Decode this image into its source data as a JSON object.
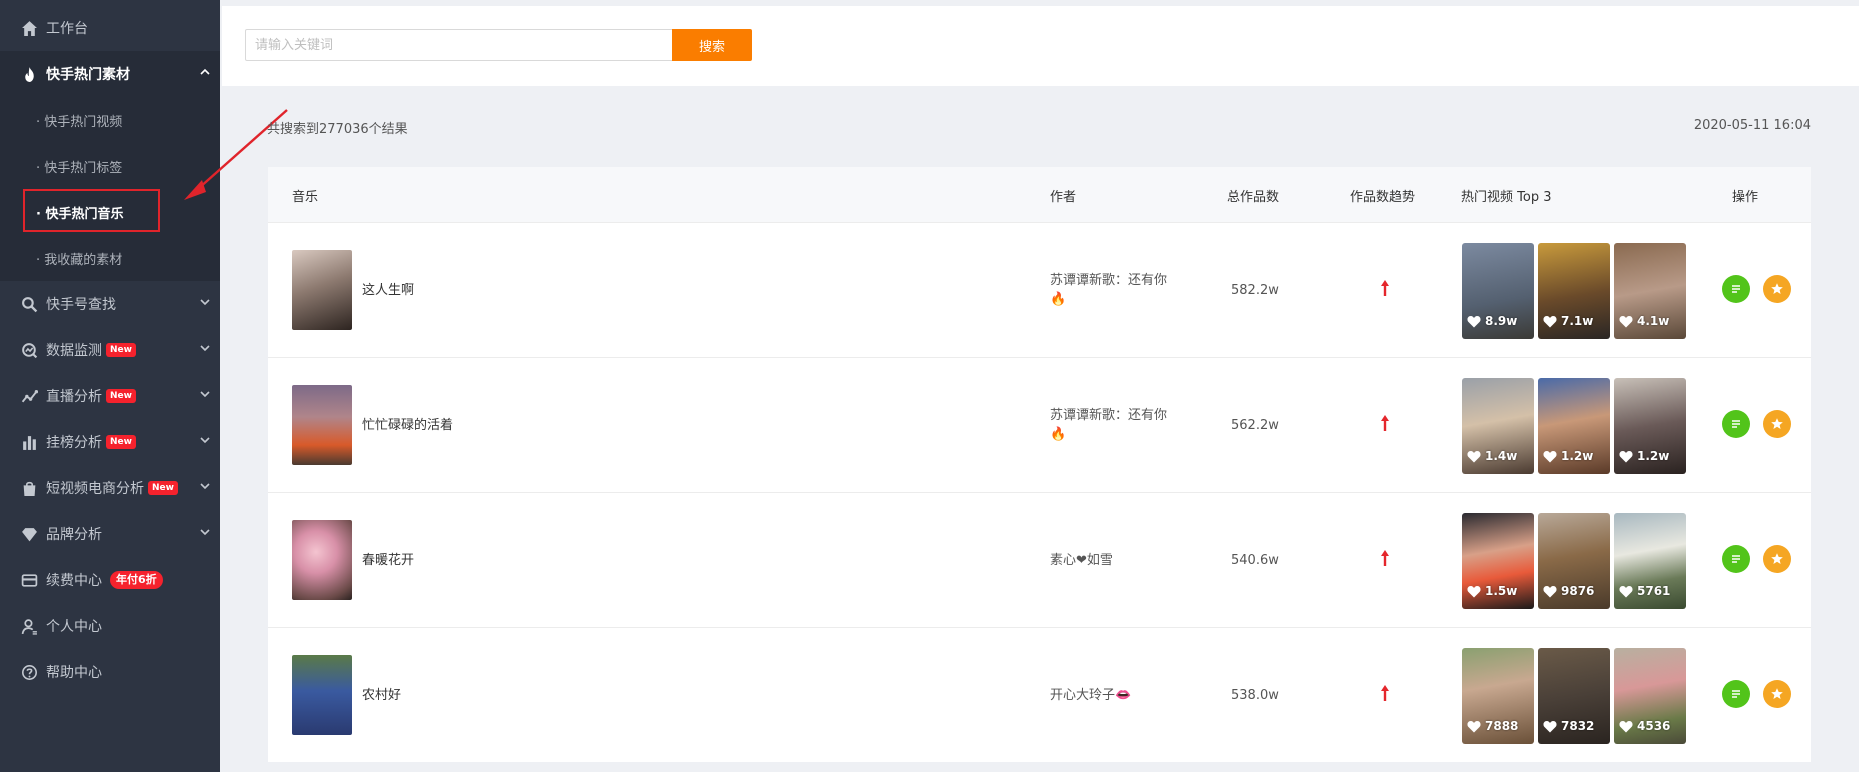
{
  "sidebar": {
    "items": [
      {
        "label": "工作台",
        "icon": "home-icon"
      },
      {
        "label": "快手热门素材",
        "icon": "fire-icon"
      },
      {
        "label": "快手号查找",
        "icon": "search-icon"
      },
      {
        "label": "数据监测",
        "icon": "monitor-icon",
        "badge": "New"
      },
      {
        "label": "直播分析",
        "icon": "line-chart-icon",
        "badge": "New"
      },
      {
        "label": "挂榜分析",
        "icon": "bar-chart-icon",
        "badge": "New"
      },
      {
        "label": "短视频电商分析",
        "icon": "shopping-bag-icon",
        "badge": "New"
      },
      {
        "label": "品牌分析",
        "icon": "diamond-icon"
      },
      {
        "label": "续费中心",
        "icon": "card-icon",
        "promo": "年付6折"
      },
      {
        "label": "个人中心",
        "icon": "user-icon"
      },
      {
        "label": "帮助中心",
        "icon": "help-icon"
      }
    ],
    "sub_items": [
      {
        "label": "· 快手热门视频"
      },
      {
        "label": "· 快手热门标签"
      },
      {
        "label": "· 快手热门音乐"
      },
      {
        "label": "· 我收藏的素材"
      }
    ]
  },
  "search": {
    "placeholder": "请输入关键词",
    "button": "搜索"
  },
  "result_count": "共搜索到277036个结果",
  "timestamp": "2020-05-11 16:04",
  "table": {
    "headers": {
      "music": "音乐",
      "author": "作者",
      "total": "总作品数",
      "trend": "作品数趋势",
      "top": "热门视频 Top 3",
      "action": "操作"
    },
    "rows": [
      {
        "song": "这人生啊",
        "author": "苏谭谭新歌：还有你",
        "author_emoji": "🔥",
        "total": "582.2w",
        "likes": [
          "8.9w",
          "7.1w",
          "4.1w"
        ]
      },
      {
        "song": "忙忙碌碌的活着",
        "author": "苏谭谭新歌：还有你",
        "author_emoji": "🔥",
        "total": "562.2w",
        "likes": [
          "1.4w",
          "1.2w",
          "1.2w"
        ]
      },
      {
        "song": "春暖花开",
        "author": "素心❤如雪",
        "author_emoji": "",
        "total": "540.6w",
        "likes": [
          "1.5w",
          "9876",
          "5761"
        ]
      },
      {
        "song": "农村好",
        "author": "开心大玲子",
        "author_emoji": "👄",
        "total": "538.0w",
        "likes": [
          "7888",
          "7832",
          "4536"
        ]
      }
    ]
  },
  "colors": {
    "accent": "#fa7d00",
    "sidebar_bg": "#2d3442",
    "highlight": "#e0242b",
    "trend_up": "#e4262c",
    "detail_btn": "#52c41a",
    "fav_btn": "#f5a623"
  }
}
